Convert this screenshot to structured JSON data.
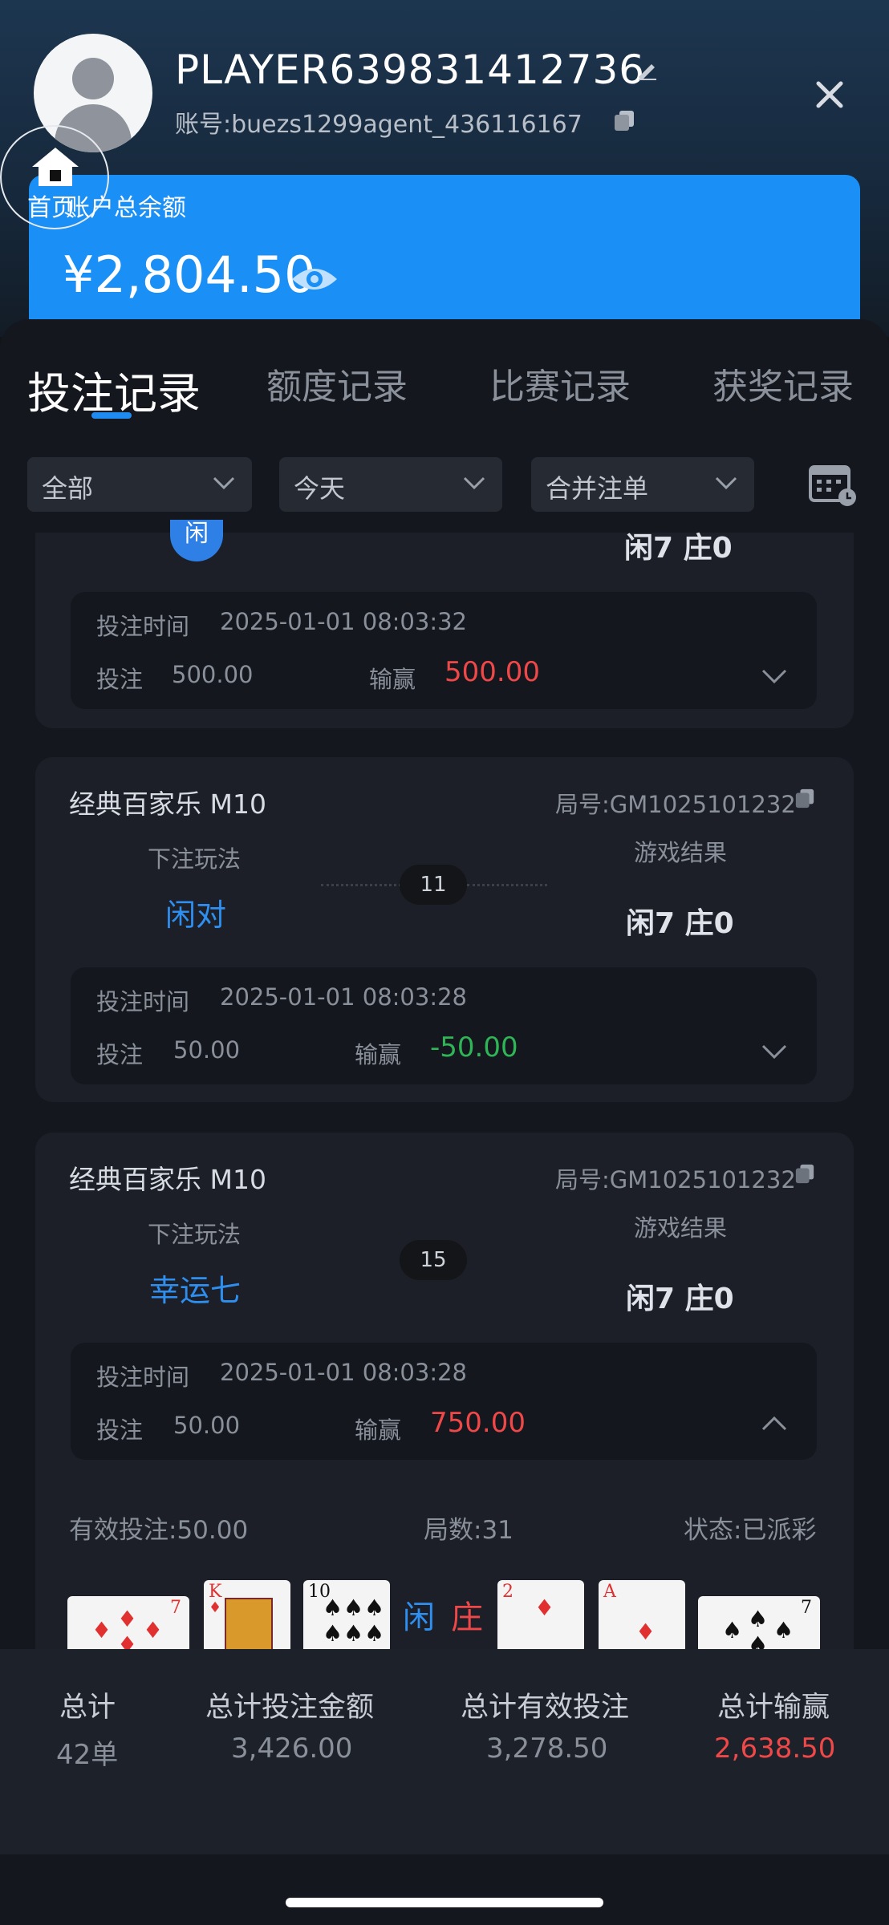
{
  "header": {
    "player_name": "PLAYER639831412736",
    "account": "账号:buezs1299agent_436116167",
    "home_label": "首页"
  },
  "balance": {
    "label": "账户总余额",
    "value": "¥2,804.50"
  },
  "tabs": [
    "投注记录",
    "额度记录",
    "比赛记录",
    "获奖记录"
  ],
  "filters": [
    "全部",
    "今天",
    "合并注单"
  ],
  "partial_card": {
    "badge": "闲",
    "result": "闲7 庄0",
    "time_label": "投注时间",
    "time": "2025-01-01 08:03:32",
    "bet_label": "投注",
    "bet": "500.00",
    "winloss_label": "输赢",
    "winloss": "500.00"
  },
  "cards": [
    {
      "game": "经典百家乐 M10",
      "round_id": "局号:GM1025101232",
      "bet_play_label": "下注玩法",
      "bet_play": "闲对",
      "result_label": "游戏结果",
      "result": "闲7 庄0",
      "hand_no": "11",
      "time_label": "投注时间",
      "time": "2025-01-01 08:03:28",
      "bet_label": "投注",
      "bet": "50.00",
      "winloss_label": "输赢",
      "winloss": "-50.00"
    },
    {
      "game": "经典百家乐 M10",
      "round_id": "局号:GM1025101232",
      "bet_play_label": "下注玩法",
      "bet_play": "幸运七",
      "result_label": "游戏结果",
      "result": "闲7 庄0",
      "hand_no": "15",
      "time_label": "投注时间",
      "time": "2025-01-01 08:03:28",
      "bet_label": "投注",
      "bet": "50.00",
      "winloss_label": "输赢",
      "winloss": "750.00",
      "details": {
        "valid_bet": "有效投注:50.00",
        "rounds": "局数:31",
        "status": "状态:已派彩",
        "player_label": "闲",
        "banker_label": "庄",
        "player_cards": [
          {
            "rank": "7",
            "suit": "♦"
          },
          {
            "rank": "K",
            "suit": "♦"
          },
          {
            "rank": "10",
            "suit": "♠"
          }
        ],
        "banker_cards": [
          {
            "rank": "2",
            "suit": "♦"
          },
          {
            "rank": "A",
            "suit": "♦"
          },
          {
            "rank": "7",
            "suit": "♠"
          }
        ]
      }
    }
  ],
  "footer": {
    "total_label": "总计",
    "total_count": "42单",
    "total_bet_label": "总计投注金额",
    "total_bet": "3,426.00",
    "total_valid_label": "总计有效投注",
    "total_valid": "3,278.50",
    "total_winloss_label": "总计输赢",
    "total_winloss": "2,638.50"
  },
  "colors": {
    "accent": "#1f8af0",
    "balance_card": "#1a8ff5",
    "win": "#f04848",
    "loss": "#2fb456"
  }
}
